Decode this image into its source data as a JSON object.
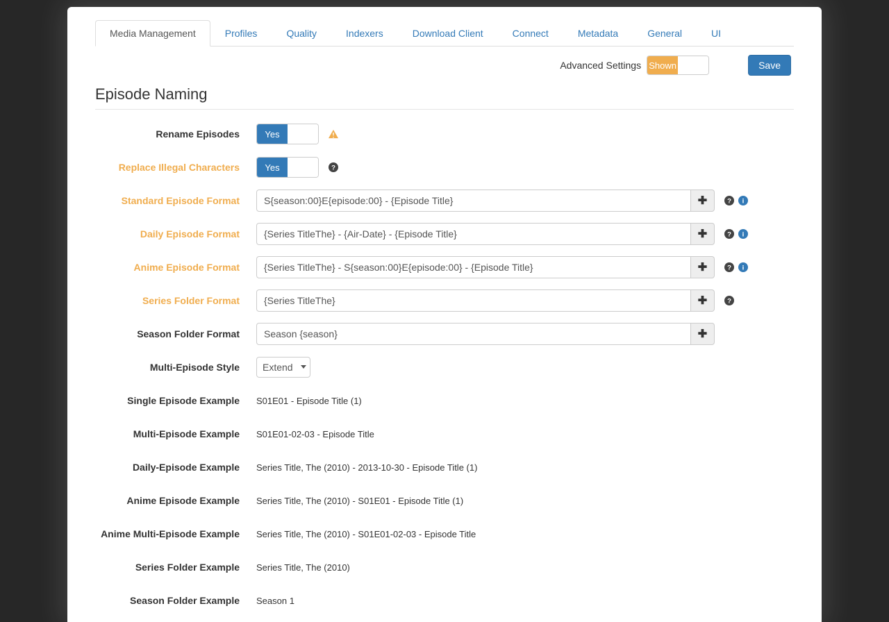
{
  "tabs": [
    "Media Management",
    "Profiles",
    "Quality",
    "Indexers",
    "Download Client",
    "Connect",
    "Metadata",
    "General",
    "UI"
  ],
  "activeTab": 0,
  "topbar": {
    "advanced_label": "Advanced Settings",
    "advanced_state": "Shown",
    "save_label": "Save"
  },
  "section_title": "Episode Naming",
  "toggles": {
    "yes_label": "Yes"
  },
  "labels": {
    "rename": "Rename Episodes",
    "replace": "Replace Illegal Characters",
    "standard": "Standard Episode Format",
    "daily": "Daily Episode Format",
    "anime": "Anime Episode Format",
    "series_folder": "Series Folder Format",
    "season_folder": "Season Folder Format",
    "multi_style": "Multi-Episode Style",
    "single_ex": "Single Episode Example",
    "multi_ex": "Multi-Episode Example",
    "daily_ex": "Daily-Episode Example",
    "anime_ex": "Anime Episode Example",
    "anime_multi_ex": "Anime Multi-Episode Example",
    "series_folder_ex": "Series Folder Example",
    "season_folder_ex": "Season Folder Example"
  },
  "values": {
    "standard": "S{season:00}E{episode:00} - {Episode Title}",
    "daily": "{Series TitleThe} - {Air-Date} - {Episode Title}",
    "anime": "{Series TitleThe} - S{season:00}E{episode:00} - {Episode Title}",
    "series_folder": "{Series TitleThe}",
    "season_folder": "Season {season}",
    "multi_style": "Extend",
    "single_ex": "S01E01 - Episode Title (1)",
    "multi_ex": "S01E01-02-03 - Episode Title",
    "daily_ex": "Series Title, The (2010) - 2013-10-30 - Episode Title (1)",
    "anime_ex": "Series Title, The (2010) - S01E01 - Episode Title (1)",
    "anime_multi_ex": "Series Title, The (2010) - S01E01-02-03 - Episode Title",
    "series_folder_ex": "Series Title, The (2010)",
    "season_folder_ex": "Season 1"
  }
}
